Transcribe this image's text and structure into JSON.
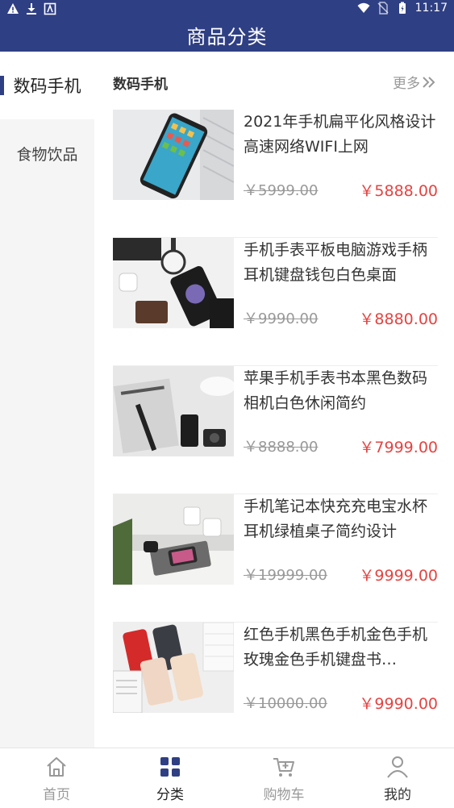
{
  "status_bar": {
    "time": "11:17"
  },
  "header": {
    "title": "商品分类"
  },
  "sidebar": {
    "items": [
      {
        "label": "数码手机",
        "active": true
      },
      {
        "label": "食物饮品",
        "active": false
      }
    ]
  },
  "section": {
    "title": "数码手机",
    "more_label": "更多"
  },
  "products": [
    {
      "name": "2021年手机扁平化风格设计高速网络WIFI上网",
      "original_price": "￥5999.00",
      "price": "￥5888.00"
    },
    {
      "name": "手机手表平板电脑游戏手柄耳机键盘钱包白色桌面",
      "original_price": "￥9990.00",
      "price": "￥8880.00"
    },
    {
      "name": "苹果手机手表书本黑色数码相机白色休闲简约",
      "original_price": "￥8888.00",
      "price": "￥7999.00"
    },
    {
      "name": "手机笔记本快充充电宝水杯耳机绿植桌子简约设计",
      "original_price": "￥19999.00",
      "price": "￥9999.00"
    },
    {
      "name": "红色手机黑色手机金色手机玫瑰金色手机键盘书…",
      "original_price": "￥10000.00",
      "price": "￥9990.00"
    }
  ],
  "tabbar": {
    "tabs": [
      {
        "label": "首页",
        "icon": "home-icon",
        "active": false
      },
      {
        "label": "分类",
        "icon": "grid-icon",
        "active": true
      },
      {
        "label": "购物车",
        "icon": "cart-icon",
        "active": false
      },
      {
        "label": "我的",
        "icon": "user-icon",
        "active": false
      }
    ]
  },
  "colors": {
    "brand": "#2f3f84",
    "price": "#e64340"
  }
}
